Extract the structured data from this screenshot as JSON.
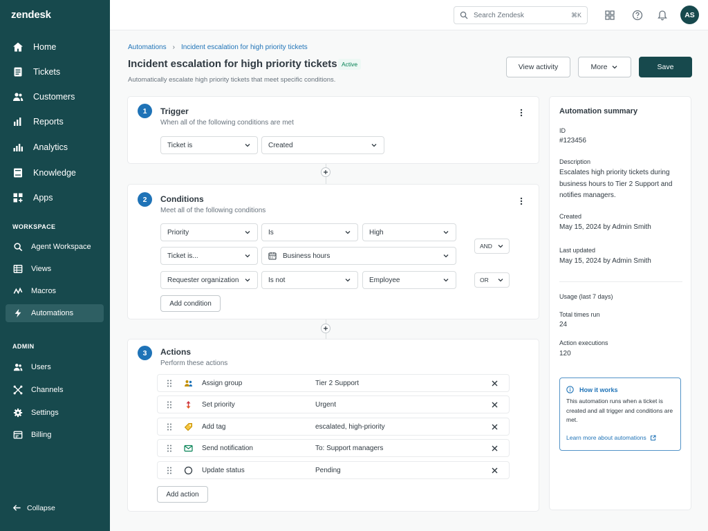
{
  "app": {
    "logo": "zendesk"
  },
  "sidebar": {
    "main_items": [
      {
        "label": "Home",
        "icon": "home-icon"
      },
      {
        "label": "Tickets",
        "icon": "tickets-icon"
      },
      {
        "label": "Customers",
        "icon": "customers-icon"
      },
      {
        "label": "Reports",
        "icon": "reports-icon"
      },
      {
        "label": "Analytics",
        "icon": "analytics-icon"
      },
      {
        "label": "Knowledge",
        "icon": "knowledge-icon"
      },
      {
        "label": "Apps",
        "icon": "apps-icon"
      }
    ],
    "workspace_heading": "WORKSPACE",
    "workspace_items": [
      {
        "label": "Agent Workspace",
        "icon": "agent-workspace-icon"
      },
      {
        "label": "Views",
        "icon": "views-icon"
      },
      {
        "label": "Macros",
        "icon": "macros-icon"
      },
      {
        "label": "Automations",
        "icon": "lightning-icon",
        "active": true
      }
    ],
    "admin_heading": "ADMIN",
    "admin_items": [
      {
        "label": "Users",
        "icon": "users-icon"
      },
      {
        "label": "Channels",
        "icon": "channels-icon"
      },
      {
        "label": "Settings",
        "icon": "gear-icon"
      },
      {
        "label": "Billing",
        "icon": "billing-icon"
      }
    ],
    "collapse_label": "Collapse"
  },
  "topbar": {
    "search_placeholder": "Search Zendesk",
    "search_shortcut": "⌘K",
    "avatar_initials": "AS"
  },
  "header": {
    "breadcrumb": [
      "Automations",
      "Incident escalation for high priority tickets"
    ],
    "title": "Incident escalation for high priority tickets",
    "status_badge": "Active",
    "subtitle": "Automatically escalate high priority tickets that meet specific conditions.",
    "view_activity_label": "View activity",
    "more_label": "More",
    "save_label": "Save"
  },
  "trigger": {
    "step": "1",
    "title": "Trigger",
    "subtitle": "When all of the following conditions are met",
    "field": "Ticket is",
    "value": "Created"
  },
  "conditions": {
    "step": "2",
    "title": "Conditions",
    "subtitle": "Meet all of the following conditions",
    "rows": [
      {
        "field": "Priority",
        "operator": "Is",
        "value": "High"
      },
      {
        "field": "Ticket is...",
        "value": "Business hours",
        "value_icon": "calendar-icon"
      },
      {
        "field": "Requester organization",
        "operator": "Is not",
        "value": "Employee"
      }
    ],
    "logic": [
      "AND",
      "OR"
    ],
    "add_label": "Add condition"
  },
  "actions": {
    "step": "3",
    "title": "Actions",
    "subtitle": "Perform these actions",
    "rows": [
      {
        "name": "Assign group",
        "value": "Tier 2 Support",
        "icon": "group-icon",
        "color": "#c38f00"
      },
      {
        "name": "Set priority",
        "value": "Urgent",
        "icon": "priority-arrows-icon",
        "color": "#cc3340"
      },
      {
        "name": "Add tag",
        "value": "escalated, high-priority",
        "icon": "tag-icon",
        "color": "#e0a800"
      },
      {
        "name": "Send notification",
        "value": "To: Support managers",
        "icon": "envelope-icon",
        "color": "#038153"
      },
      {
        "name": "Update status",
        "value": "Pending",
        "icon": "circle-icon",
        "color": "#2f3941"
      }
    ],
    "add_label": "Add action"
  },
  "summary": {
    "title": "Automation summary",
    "id_label": "ID",
    "id_value": "#123456",
    "description_label": "Description",
    "description_value": "Escalates high priority tickets during business hours to Tier 2 Support and notifies managers.",
    "created_label": "Created",
    "created_value": "May 15, 2024 by Admin Smith",
    "updated_label": "Last updated",
    "updated_value": "May 15, 2024 by Admin Smith",
    "usage_label": "Usage (last 7 days)",
    "total_runs_label": "Total times run",
    "total_runs_value": "24",
    "executions_label": "Action executions",
    "executions_value": "120",
    "info_title": "How it works",
    "info_text": "This automation runs when a ticket is created and all trigger and conditions are met.",
    "info_link": "Learn more about automations"
  },
  "colors": {
    "sidebar": "#17494d",
    "accent": "#1f73b7",
    "primary_button": "#17494d",
    "active_badge": "#038153"
  }
}
